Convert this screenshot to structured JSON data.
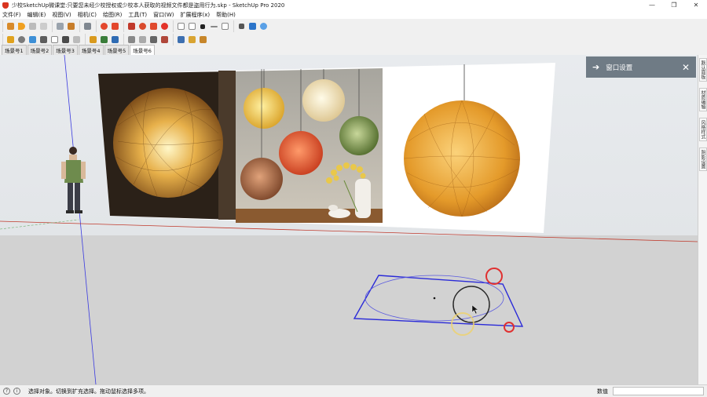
{
  "window": {
    "title": "少校SketchUp微课堂:只要您未经少校授权或少校本人获取的视频文件都是盗用行为.skp - SketchUp Pro 2020",
    "minimize": "—",
    "maximize": "❐",
    "close": "✕"
  },
  "menu": [
    "文件(F)",
    "编辑(E)",
    "视图(V)",
    "相机(C)",
    "绘图(R)",
    "工具(T)",
    "窗口(W)",
    "扩展程序(x)",
    "帮助(H)"
  ],
  "scenes": {
    "tabs": [
      "场景号1",
      "场景号2",
      "场景号3",
      "场景号4",
      "场景号5",
      "场景号6"
    ],
    "active_index": 5
  },
  "tray": {
    "tabs": [
      "默认面板",
      "材质编辑",
      "风格样式",
      "阴影设置"
    ],
    "window_settings": {
      "arrow": "➔",
      "title": "窗口设置",
      "close": "✕"
    }
  },
  "status": {
    "message": "选择对象。切换到扩充选择。拖动鼠标选择多项。",
    "measurement_label": "数值",
    "measurement_value": ""
  },
  "colors": {
    "sky": "#e6e9ec",
    "ground": "#d2d2d2",
    "selection_blue": "#2a2ad8",
    "red_axis": "#c0392b",
    "panel_header": "#6f7b85"
  }
}
